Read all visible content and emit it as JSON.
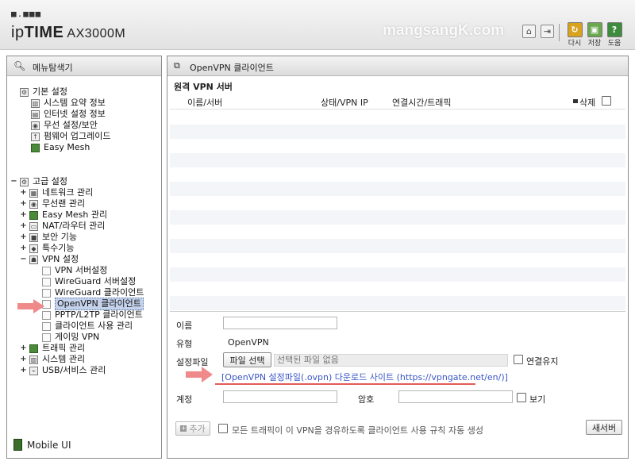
{
  "header": {
    "logo_dots": "■.■■■",
    "brand_ip": "ip",
    "brand_time": "TIME",
    "brand_model": " AX3000M",
    "watermark": "mangsangK.com",
    "buttons": [
      {
        "name": "reload",
        "label": "다시",
        "color": "#d9a21f",
        "glyph": "↻"
      },
      {
        "name": "save",
        "label": "저장",
        "color": "#6aa84f",
        "glyph": "▣"
      },
      {
        "name": "help",
        "label": "도움",
        "color": "#3d8b3d",
        "glyph": "?"
      }
    ]
  },
  "sidebar": {
    "title": "메뉴탐색기",
    "basic": {
      "label": "기본 설정",
      "items": [
        "시스템 요약 정보",
        "인터넷 설정 정보",
        "무선 설정/보안",
        "펌웨어 업그레이드",
        "Easy Mesh"
      ]
    },
    "advanced": {
      "label": "고급 설정",
      "items": [
        "네트워크 관리",
        "무선랜 관리",
        "Easy Mesh 관리",
        "NAT/라우터 관리",
        "보안 기능",
        "특수기능"
      ],
      "vpn": {
        "label": "VPN 설정",
        "items": [
          "VPN 서버설정",
          "WireGuard 서버설정",
          "WireGuard 클라이언트",
          "OpenVPN 클라이언트",
          "PPTP/L2TP 클라이언트",
          "클라이언트 사용 관리",
          "게이밍 VPN"
        ],
        "selected_index": 3
      },
      "more": [
        "트래픽 관리",
        "시스템 관리",
        "USB/서비스 관리"
      ]
    },
    "mobile_ui": "Mobile UI"
  },
  "main": {
    "title": "OpenVPN 클라이언트",
    "section": "원격 VPN 서버",
    "columns": {
      "name": "이름/서버",
      "status": "상태/VPN IP",
      "time": "연결시간/트래픽",
      "delete": "삭제"
    },
    "form": {
      "name_label": "이름",
      "name_value": "",
      "type_label": "유형",
      "type_value": "OpenVPN",
      "file_label": "설정파일",
      "file_button": "파일 선택",
      "file_none": "선택된 파일 없음",
      "keep_label": "연결유지",
      "link_text": "[OpenVPN 설정파일(.ovpn) 다운로드 사이트 (https://vpngate.net/en/)]",
      "account_label": "계정",
      "account_value": "",
      "password_label": "암호",
      "password_value": "",
      "view_label": "보기",
      "add_button": "추가",
      "all_traffic_label": "모든 트래픽이 이 VPN을 경유하도록 클라이언트 사용 규칙 자동 생성",
      "refresh_button": "새서버"
    }
  },
  "colors": {
    "accent": "#3b56c8",
    "arrow": "#f08a8a",
    "underline": "#e35a5a"
  }
}
